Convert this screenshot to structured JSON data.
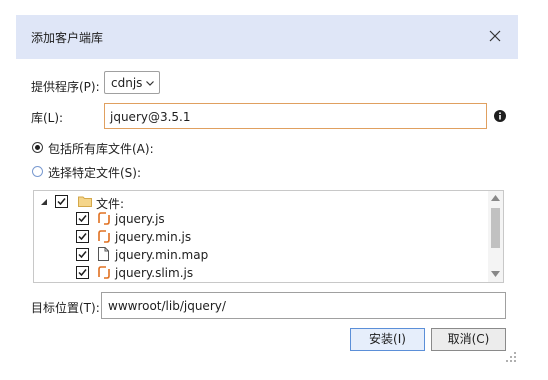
{
  "dialog": {
    "title": "添加客户端库",
    "provider_label": "提供程序(P):",
    "provider_value": "cdnjs",
    "library_label": "库(L):",
    "library_value": "jquery@3.5.1",
    "include_all_label": "包括所有库文件(A):",
    "choose_files_label": "选择特定文件(S):",
    "tree": {
      "folder": "文件:",
      "files": [
        {
          "name": "jquery.js",
          "icon": "js-file-icon"
        },
        {
          "name": "jquery.min.js",
          "icon": "js-file-icon"
        },
        {
          "name": "jquery.min.map",
          "icon": "map-file-icon"
        },
        {
          "name": "jquery.slim.js",
          "icon": "js-file-icon"
        }
      ]
    },
    "target_label": "目标位置(T):",
    "target_value": "wwwroot/lib/jquery/",
    "install_button": "安装(I)",
    "cancel_button": "取消(C)"
  },
  "colors": {
    "titlebar": "#dfe6f7",
    "input_focus_border": "#e0a060",
    "js_icon": "#e07020",
    "primary_border": "#5b8fd8"
  }
}
